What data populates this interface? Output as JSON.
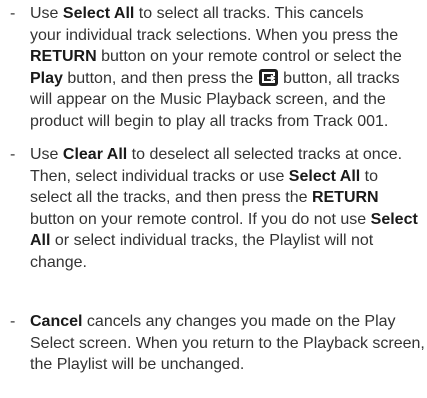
{
  "item1": {
    "dash": "-",
    "l1_a": "Use ",
    "l1_b": "Select All",
    "l1_c": " to select all tracks. This cancels",
    "l2": "your individual track selections. When you press the",
    "l3_a": "RETURN",
    "l3_b": " button on your remote control or select the",
    "l4_a": "Play",
    "l4_b": " button, and then press the ",
    "l4_c": " button, all tracks",
    "l4_icon": "enter-button-icon",
    "l5": "will appear on the Music Playback screen, and the",
    "l6": "product will begin to play all tracks from Track 001."
  },
  "item2": {
    "dash": "-",
    "l1_a": "Use ",
    "l1_b": "Clear All",
    "l1_c": " to deselect all selected tracks at once.",
    "l2_a": "Then, select individual tracks or use ",
    "l2_b": "Select All",
    "l2_c": " to",
    "l3_a": "select all the tracks, and then press the ",
    "l3_b": "RETURN",
    "l4": "button on your remote control. If you do not use ",
    "l4_b": "Select",
    "l5_a": "All",
    "l5_b": " or select individual tracks, the Playlist will not",
    "l6": "change."
  },
  "item3": {
    "dash": "-",
    "l1_a": "Cancel",
    "l1_b": " cancels any changes you made on the Play",
    "l2": "Select screen. When you return to the Playback screen,",
    "l3": "the Playlist will be unchanged."
  }
}
